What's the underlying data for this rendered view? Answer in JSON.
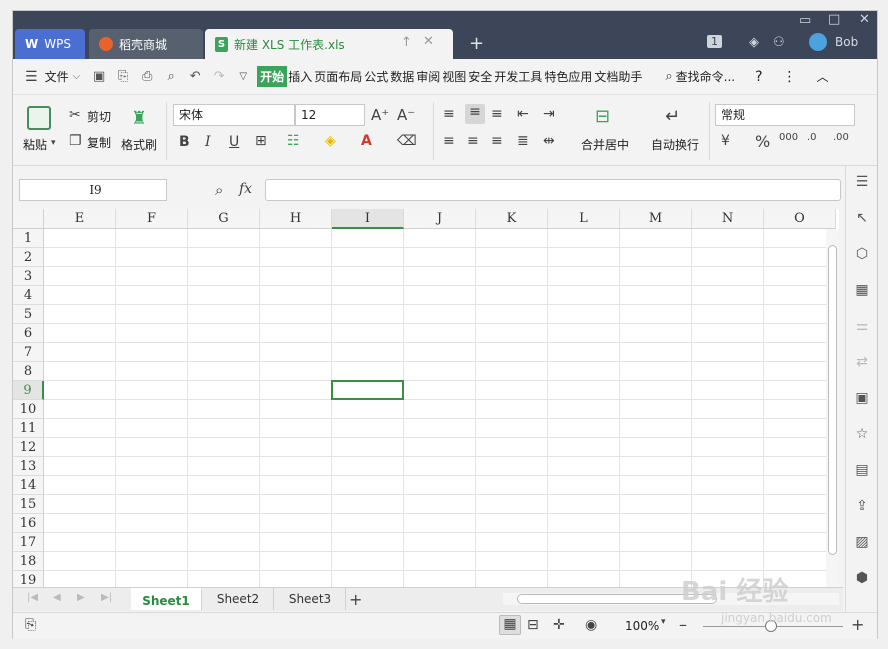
{
  "tabs": {
    "wps": "WPS",
    "daoke": "稻壳商城",
    "doc": "新建 XLS 工作表.xls",
    "new_tab": "+"
  },
  "user": {
    "badge": "1",
    "name": "Bob"
  },
  "menu": {
    "file": "文件",
    "items": [
      "开始",
      "插入",
      "页面布局",
      "公式",
      "数据",
      "审阅",
      "视图",
      "安全",
      "开发工具",
      "特色应用",
      "文档助手"
    ],
    "active": "开始",
    "search": "查找命令...",
    "help": "?"
  },
  "ribbon": {
    "paste": "粘贴",
    "cut": "剪切",
    "copy": "复制",
    "format_painter": "格式刷",
    "font_name": "宋体",
    "font_size": "12",
    "merge": "合并居中",
    "wrap": "自动换行",
    "number_format": "常规",
    "percent": "%"
  },
  "formula_bar": {
    "cell_ref": "I9",
    "fx": "fx",
    "value": ""
  },
  "grid": {
    "columns": [
      "E",
      "F",
      "G",
      "H",
      "I",
      "J",
      "K",
      "L",
      "M",
      "N",
      "O"
    ],
    "rows": [
      "1",
      "2",
      "3",
      "4",
      "5",
      "6",
      "7",
      "8",
      "9",
      "10",
      "11",
      "12",
      "13",
      "14",
      "15",
      "16",
      "17",
      "18",
      "19"
    ],
    "selected_column": "I",
    "selected_row": "9"
  },
  "sheets": {
    "items": [
      "Sheet1",
      "Sheet2",
      "Sheet3"
    ],
    "active": "Sheet1",
    "add": "+"
  },
  "status": {
    "zoom": "100%"
  },
  "watermark": {
    "main": "Bai 经验",
    "sub": "jingyan.baidu.com"
  },
  "colors": {
    "accent": "#3aa45a",
    "titlebar": "#3c4658",
    "wps_tab": "#4a6fd1"
  }
}
